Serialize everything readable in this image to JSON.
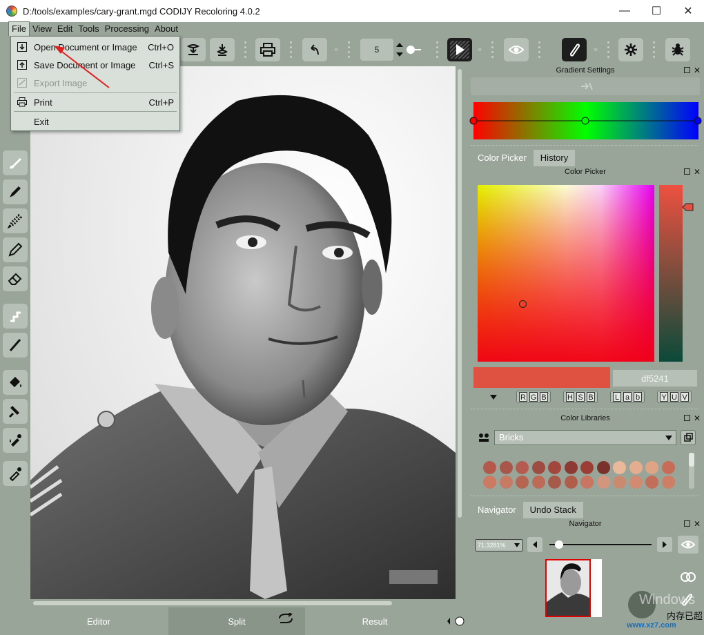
{
  "window": {
    "title": "D:/tools/examples/cary-grant.mgd CODIJY Recoloring 4.0.2",
    "minimize_glyph": "—",
    "maximize_glyph": "☐",
    "close_glyph": "✕"
  },
  "menubar": {
    "items": [
      "File",
      "View",
      "Edit",
      "Tools",
      "Processing",
      "About"
    ]
  },
  "file_menu": {
    "items": [
      {
        "label": "Open Document or Image",
        "shortcut": "Ctrl+O",
        "icon": "open-icon",
        "enabled": true
      },
      {
        "label": "Save Document or Image",
        "shortcut": "Ctrl+S",
        "icon": "save-icon",
        "enabled": true
      },
      {
        "label": "Export Image",
        "shortcut": "",
        "icon": "export-icon",
        "enabled": false
      },
      {
        "label": "Print",
        "shortcut": "Ctrl+P",
        "icon": "print-icon",
        "enabled": true
      },
      {
        "label": "Exit",
        "shortcut": "",
        "icon": "",
        "enabled": true
      }
    ]
  },
  "toolbar": {
    "brush_size": "5",
    "icons": [
      "download-icon",
      "stamp-icon",
      "print-icon",
      "undo-icon",
      "size-stepper",
      "play-icon",
      "eye-icon",
      "brush-mode-icon",
      "gear-icon",
      "bug-icon"
    ]
  },
  "left_tools": [
    "brush-icon",
    "marker-icon",
    "dotted-brush-icon",
    "pencil-icon",
    "eraser-icon",
    "gradient-stroke-icon",
    "line-icon",
    "fill-bucket-icon",
    "hammer-icon",
    "dropper-color-icon",
    "eyedropper-icon"
  ],
  "bottom_tabs": {
    "editor": "Editor",
    "split": "Split",
    "result": "Result"
  },
  "gradient_settings": {
    "title": "Gradient Settings",
    "colors": [
      "#ff0000",
      "#00ff00",
      "#0000ff"
    ]
  },
  "color_picker": {
    "tab_active": "Color Picker",
    "tab_other": "History",
    "title": "Color Picker",
    "hex_value": "df5241",
    "current_color": "#df5241",
    "model_rgb": [
      "R",
      "G",
      "B"
    ],
    "model_hsb": [
      "H",
      "S",
      "B"
    ],
    "model_lab": [
      "L",
      "a",
      "b"
    ],
    "model_yuv": [
      "Y",
      "U",
      "V"
    ]
  },
  "color_libraries": {
    "title": "Color Libraries",
    "selected": "Bricks",
    "swatches": [
      "#b3594c",
      "#a8564a",
      "#b55b4f",
      "#9e4c42",
      "#a3463d",
      "#8c3a33",
      "#9a3e36",
      "#7a302b",
      "#eab89a",
      "#e5ad90",
      "#dfa485",
      "#c76d57",
      "#cc7a62",
      "#c77a64",
      "#b56552",
      "#bd6a56",
      "#a85a4a",
      "#b05d4c",
      "#c87561",
      "#d4957e",
      "#c98a70",
      "#d48a70",
      "#c26e5a",
      "#cf7e66"
    ]
  },
  "navigator": {
    "tab_active": "Navigator",
    "tab_other": "Undo Stack",
    "title": "Navigator",
    "zoom": "71.3281%"
  },
  "watermark": {
    "text1": "Windows",
    "text2": "内存已超",
    "text3": "www.xz7.com"
  }
}
